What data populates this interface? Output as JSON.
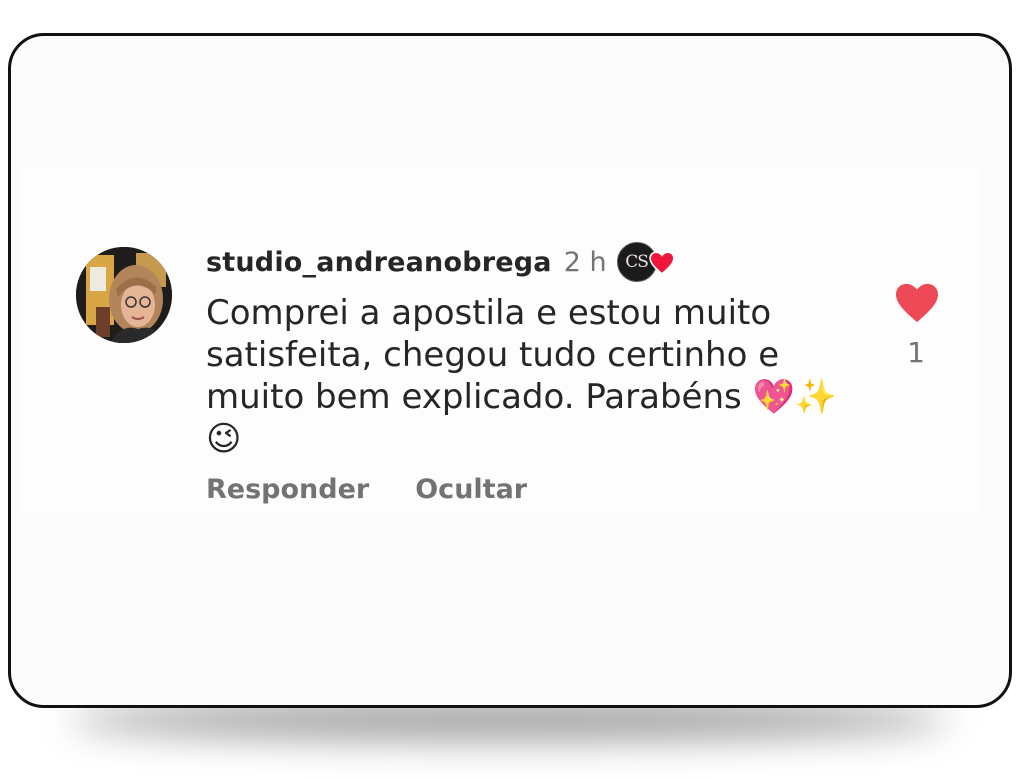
{
  "comment": {
    "username": "studio_andreanobrega",
    "time": "2 h",
    "creator_badge_text": "CS",
    "creator_badge_icon": "creator-liked-heart-icon",
    "text": "Comprei a apostila e estou muito satisfeita, chegou tudo certinho e muito bem explicado. Parabéns 💖✨😉",
    "actions": {
      "reply": "Responder",
      "hide": "Ocultar"
    },
    "likes": {
      "count": "1",
      "liked": true,
      "icon": "heart-icon",
      "color": "#ed4956"
    }
  }
}
